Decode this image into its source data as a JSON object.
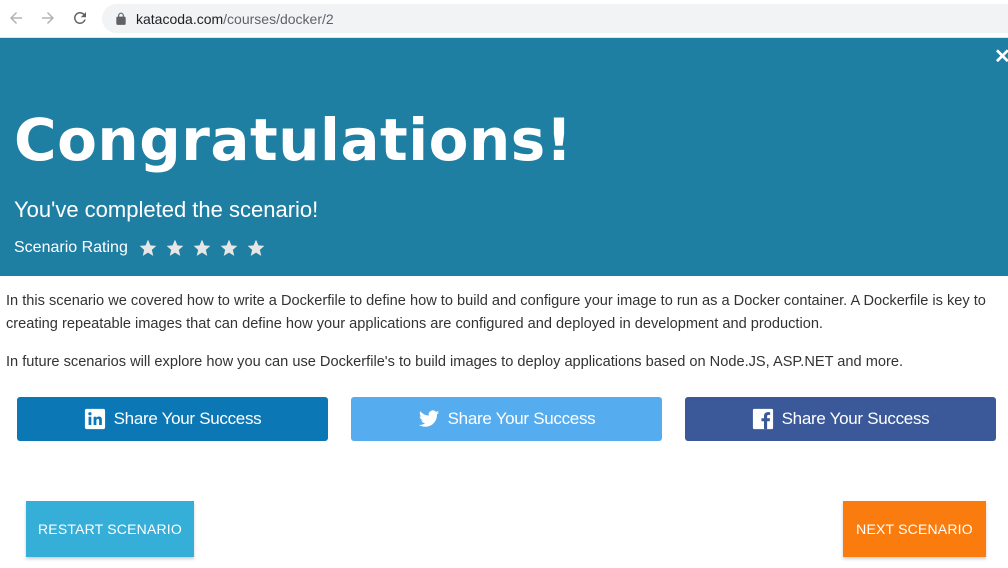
{
  "browser": {
    "url_domain": "katacoda.com",
    "url_path": "/courses/docker/2"
  },
  "hero": {
    "close_glyph": "✕",
    "title": "Congratulations!",
    "subtitle": "You've completed the scenario!",
    "rating_label": "Scenario Rating",
    "rating_max": 5,
    "rating_value": 0,
    "background": "#1e7fa3"
  },
  "content": {
    "paragraph1": "In this scenario we covered how to write a Dockerfile to define how to build and configure your image to run as a Docker container. A Dockerfile is key to creating repeatable images that can define how your applications are configured and deployed in development and production.",
    "paragraph2": "In future scenarios will explore how you can use Dockerfile's to build images to deploy applications based on Node.JS, ASP.NET and more."
  },
  "share": {
    "linkedin": {
      "label": "Share Your Success",
      "icon": "linkedin-icon",
      "color": "#0b77b5"
    },
    "twitter": {
      "label": "Share Your Success",
      "icon": "twitter-icon",
      "color": "#55acee"
    },
    "facebook": {
      "label": "Share Your Success",
      "icon": "facebook-icon",
      "color": "#3b5998"
    }
  },
  "actions": {
    "restart_label": "RESTART SCENARIO",
    "next_label": "NEXT SCENARIO",
    "restart_color": "#35aed8",
    "next_color": "#fb7c0e"
  }
}
